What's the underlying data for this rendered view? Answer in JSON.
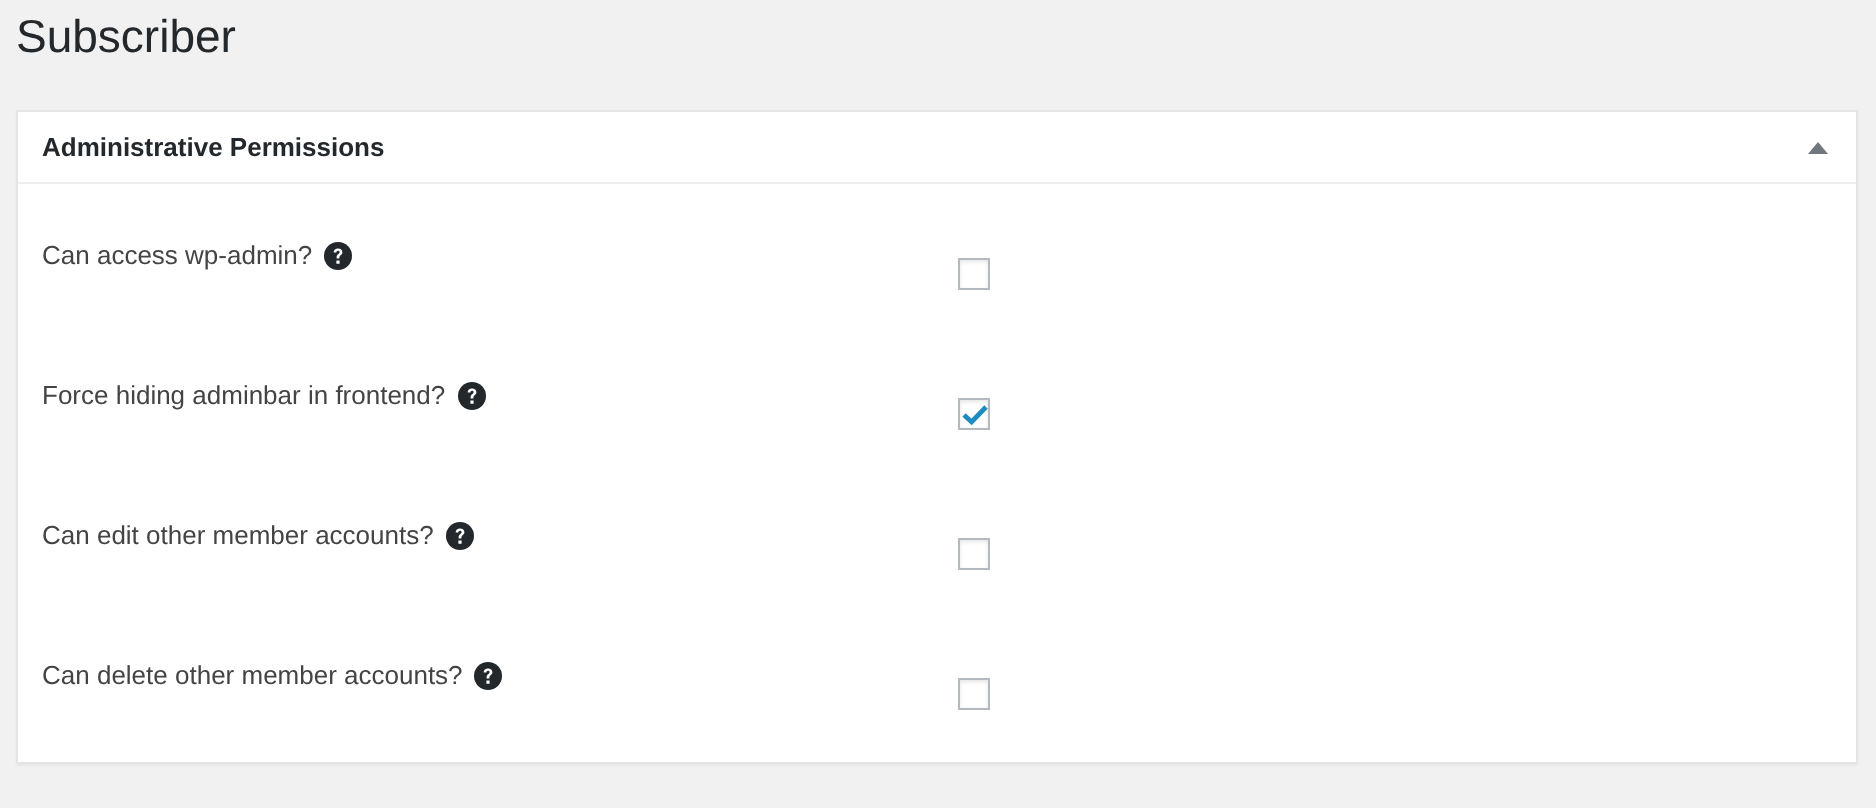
{
  "page_title": "Subscriber",
  "panel": {
    "title": "Administrative Permissions",
    "expanded": true,
    "settings": [
      {
        "label": "Can access wp-admin?",
        "checked": false
      },
      {
        "label": "Force hiding adminbar in frontend?",
        "checked": true
      },
      {
        "label": "Can edit other member accounts?",
        "checked": false
      },
      {
        "label": "Can delete other member accounts?",
        "checked": false
      }
    ]
  }
}
